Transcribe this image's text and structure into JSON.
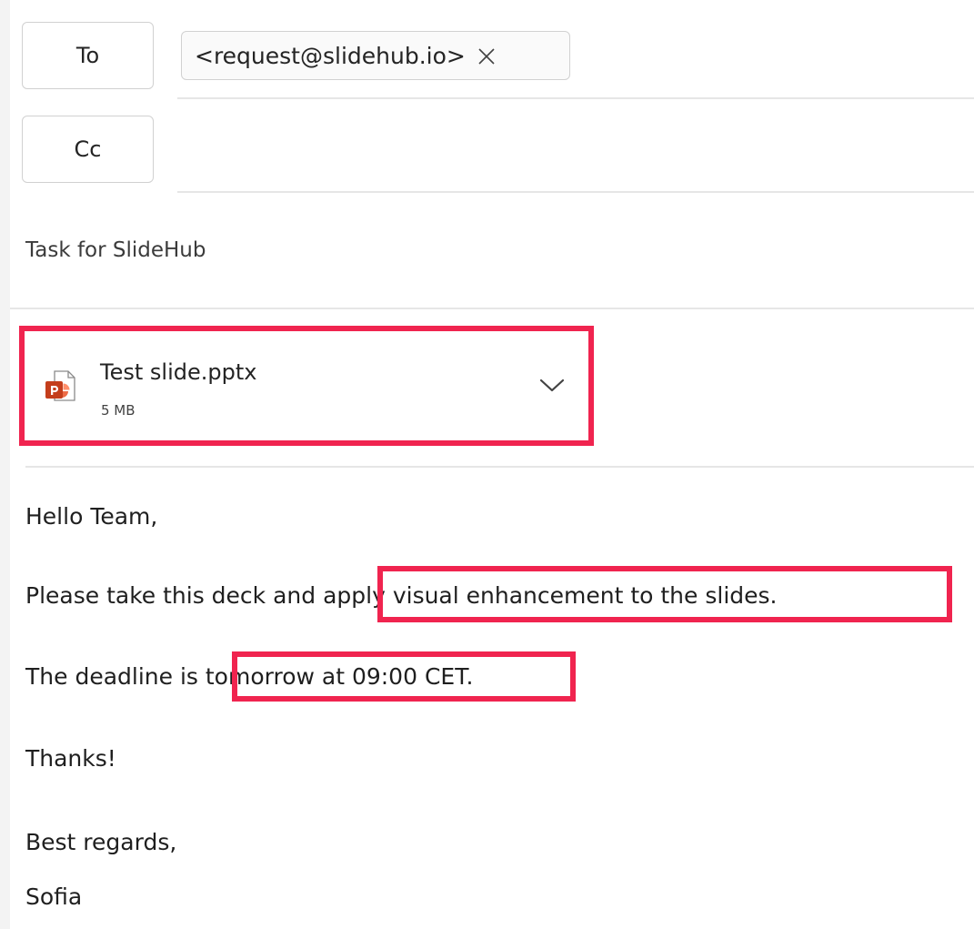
{
  "recipients": {
    "to_label": "To",
    "cc_label": "Cc",
    "to_chip": "<request@slidehub.io>"
  },
  "subject": "Task for SlideHub",
  "attachment": {
    "name": "Test slide.pptx",
    "size": "5 MB",
    "icon": "powerpoint-file-icon"
  },
  "body": {
    "greeting": "Hello Team,",
    "line1_prefix": "Please take this deck and ",
    "line1_highlight": "apply visual enhancement to the slides.",
    "line2_prefix": "The deadline is ",
    "line2_highlight": "tomorrow at 09:00 CET.",
    "thanks": "Thanks!",
    "closing": "Best regards,",
    "signature": "Sofia"
  },
  "colors": {
    "highlight_border": "#f0244f",
    "powerpoint": "#c43e1c"
  }
}
